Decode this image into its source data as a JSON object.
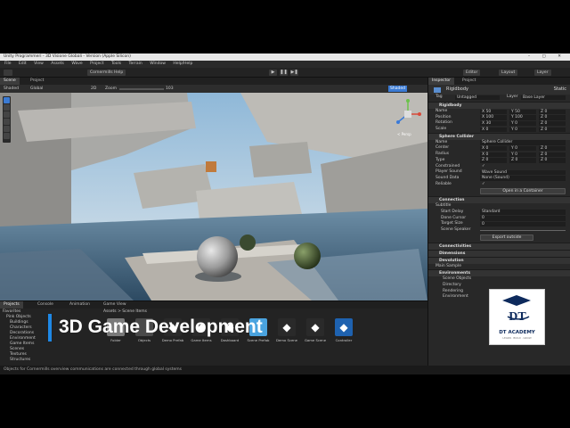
{
  "window": {
    "title": "Unity Programmeri - 3D Visione Globali - Version (Apple Silicon)",
    "controls": "–  ▢  ✕"
  },
  "menu": [
    "File",
    "Edit",
    "View",
    "Assets",
    "Wave",
    "Project",
    "Tools",
    "Terrain",
    "Window",
    "Help/Help"
  ],
  "toolbar": {
    "account": "Cornermills Help",
    "play_icons": [
      "▶",
      "❚❚",
      "▶❚"
    ],
    "right_buttons": [
      "Editor",
      "Layout",
      "Layer"
    ]
  },
  "scene_tabs": [
    "Scene",
    "Project"
  ],
  "scene_bar": {
    "left": "Shaded",
    "mode": "Global",
    "mid": "2D",
    "zoom_label": "Zoom",
    "zoom_value": "103",
    "right": "Shaded"
  },
  "gizmo": {
    "label": "< Persp"
  },
  "bottom": {
    "tabs": [
      "Projects",
      "Console",
      "Animation",
      "Game View"
    ],
    "tree": [
      "Favorites",
      "Pink Objects",
      "Buildings",
      "Characters",
      "Decorations",
      "Environment",
      "Game Items",
      "Scenes",
      "Textures",
      "Structures",
      "Scripts",
      "Sources"
    ],
    "breadcrumb": "Assets  >  Scene Items",
    "assets": [
      {
        "label": "Folder",
        "color": "#7a7a7a"
      },
      {
        "label": "Objects",
        "color": "#4a4a4a"
      },
      {
        "label": "Demo Prefab",
        "color": "#2a2a2a"
      },
      {
        "label": "Game Items",
        "color": "#2a2a2a"
      },
      {
        "label": "Dashboard",
        "color": "#2a2a2a"
      },
      {
        "label": "Scene Prefab",
        "color": "#4aa3df"
      },
      {
        "label": "Demo Scene",
        "color": "#2a2a2a"
      },
      {
        "label": "Game Scene",
        "color": "#2a2a2a"
      },
      {
        "label": "Controller",
        "color": "#1e62b0"
      }
    ],
    "status": "Objects for Cornermills overview communications are connected through global systems"
  },
  "inspector": {
    "tabs": [
      "Inspector",
      "Project"
    ],
    "object_name": "Rigidbody",
    "static_label": "Static",
    "tag_label": "Tag",
    "tag_value": "Untagged",
    "layer_label": "Layer",
    "layer_value": "Base Layer",
    "sections": [
      {
        "title": "Rigidbody",
        "rows": [
          {
            "label": "Name",
            "values": [
              "X 50",
              "Y 50",
              "Z 0"
            ]
          },
          {
            "label": "Position",
            "values": [
              "X 100",
              "Y 100",
              "Z 0"
            ]
          },
          {
            "label": "Rotation",
            "values": [
              "X 30",
              "Y 0",
              "Z 0"
            ]
          },
          {
            "label": "Scale",
            "values": [
              "X 0",
              "Y 0",
              "Z 0"
            ]
          }
        ]
      },
      {
        "title": "Sphere Collider",
        "rows": [
          {
            "label": "Name",
            "values": [
              "Sphere Collider"
            ]
          },
          {
            "label": "Center",
            "values": [
              "X 0",
              "Y 0",
              "Z 0"
            ]
          },
          {
            "label": "Radius",
            "values": [
              "X 0",
              "Y 0",
              "Z 0"
            ]
          },
          {
            "label": "Type",
            "values": [
              "Z 0",
              "Z 0",
              "Z 0"
            ]
          },
          {
            "label": "Constrained",
            "values": [
              "✓"
            ]
          },
          {
            "label": "Player Sound",
            "values": [
              "Wave Sound"
            ]
          },
          {
            "label": "Sound Data",
            "values": [
              "None (Sound)"
            ]
          },
          {
            "label": "Reliable",
            "values": [
              "✓"
            ]
          }
        ],
        "button": "Open in a Container"
      },
      {
        "title": "Connection",
        "rows": [
          {
            "label": "Subtitle",
            "values": [
              ""
            ]
          },
          {
            "label": "Start Delay",
            "values": [
              "Standard"
            ]
          },
          {
            "label": "Done Cursor",
            "values": [
              "0"
            ]
          },
          {
            "label": "Target Size",
            "values": [
              "0"
            ]
          },
          {
            "label": "Scene Speaker",
            "values": [
              ""
            ]
          }
        ],
        "button": "Export outside"
      }
    ],
    "collapsed": [
      "Connectivities",
      "Dimensions",
      "Devolution"
    ],
    "extra": "Main Sample",
    "groups_title": "Environments",
    "groups": [
      "Scene Objects",
      "Directory",
      "Rendering",
      "Environment"
    ]
  },
  "overlay": {
    "title": "3D Game Development",
    "logo_monogram": "DT",
    "logo_name": "DT ACADEMY",
    "logo_sub": "LEARN · BUILD · GROW"
  }
}
